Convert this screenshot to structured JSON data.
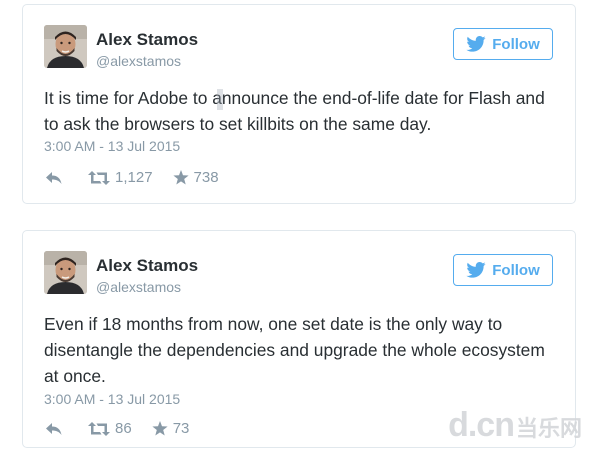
{
  "tweets": [
    {
      "author": {
        "name": "Alex Stamos",
        "handle": "@alexstamos"
      },
      "follow_label": "Follow",
      "text": "It is time for Adobe to announce the end-of-life date for Flash and to ask the browsers to set killbits on the same day.",
      "timestamp": "3:00 AM - 13 Jul 2015",
      "retweets": "1,127",
      "favorites": "738"
    },
    {
      "author": {
        "name": "Alex Stamos",
        "handle": "@alexstamos"
      },
      "follow_label": "Follow",
      "text": "Even if 18 months from now, one set date is the only way to disentangle the dependencies and upgrade the whole ecosystem at once.",
      "timestamp": "3:00 AM - 13 Jul 2015",
      "retweets": "86",
      "favorites": "73"
    }
  ],
  "watermark": {
    "latin": "d.cn",
    "chinese": "当乐网"
  },
  "colors": {
    "accent": "#55acee",
    "text": "#292f33",
    "muted": "#8899a6",
    "border": "#e1e8ed"
  },
  "icons": [
    "twitter-bird-icon",
    "reply-icon",
    "retweet-icon",
    "favorite-star-icon"
  ]
}
